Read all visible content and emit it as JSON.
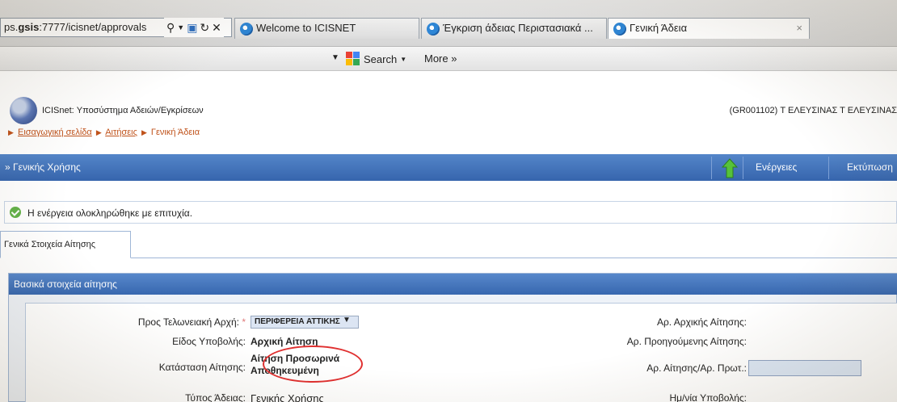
{
  "browser": {
    "address_prefix": "ps.",
    "address_host": "gsis",
    "address_rest": ":7777/icisnet/approvals",
    "tabs": [
      {
        "label": "Welcome to ICISNET"
      },
      {
        "label": "Έγκριση άδειας Περιστασιακά ..."
      },
      {
        "label": "Γενική Άδεια"
      }
    ],
    "close_glyph": "×"
  },
  "commandbar": {
    "search_label": "Search",
    "more_label": "More »"
  },
  "app": {
    "title": "ICISnet: Υποσύστημα Αδειών/Εγκρίσεων",
    "user": "(GR001102) Τ ΕΛΕΥΣΙΝΑΣ Τ ΕΛΕΥΣΙΝΑΣ",
    "breadcrumb": [
      "Εισαγωγική σελίδα",
      "Αιτήσεις",
      "Γενική Άδεια"
    ]
  },
  "toolbar": {
    "title": "» Γενικής Χρήσης",
    "actions_label": "Ενέργειες",
    "print_label": "Εκτύπωση"
  },
  "message": {
    "text": "Η ενέργεια ολοκληρώθηκε με επιτυχία."
  },
  "tabs": [
    {
      "label": "Γενικά Στοιχεία Αίτησης"
    }
  ],
  "panel": {
    "title": "Βασικά στοιχεία αίτησης",
    "fields": {
      "authority_label": "Προς Τελωνειακή Αρχή:",
      "authority_value": "ΠΕΡΙΦΕΡΕΙΑ ΑΤΤΙΚΗΣ",
      "submission_type_label": "Είδος Υποβολής:",
      "submission_type_value": "Αρχική Αίτηση",
      "status_label": "Κατάσταση Αίτησης:",
      "status_value_line1": "Αίτηση Προσωρινά",
      "status_value_line2": "Αποθηκευμένη",
      "permit_type_label": "Τύπος Άδειας:",
      "permit_type_value": "Γενικής Χρήσης",
      "original_no_label": "Αρ. Αρχικής Αίτησης:",
      "previous_no_label": "Αρ. Προηγούμενης Αίτησης:",
      "app_protocol_label": "Αρ. Αίτησης/Αρ. Πρωτ.:",
      "submission_date_label": "Ημ/νία Υποβολής:"
    }
  },
  "colors": {
    "accent_blue": "#3665ad",
    "breadcrumb_orange": "#c0531c",
    "success_green": "#64b24a",
    "highlight_red": "#e03030"
  }
}
